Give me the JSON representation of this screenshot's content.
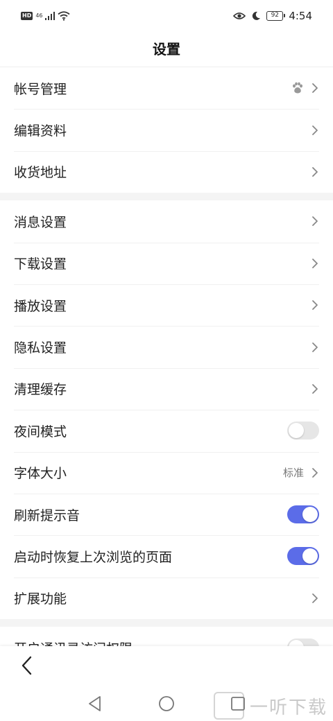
{
  "status_bar": {
    "hd": "HD",
    "network": "46",
    "battery": "92",
    "time": "4:54"
  },
  "header": {
    "title": "设置"
  },
  "sections": [
    [
      {
        "label": "帐号管理",
        "right": "chevron",
        "icon": "paw-icon"
      },
      {
        "label": "编辑资料",
        "right": "chevron"
      },
      {
        "label": "收货地址",
        "right": "chevron"
      }
    ],
    [
      {
        "label": "消息设置",
        "right": "chevron"
      },
      {
        "label": "下载设置",
        "right": "chevron"
      },
      {
        "label": "播放设置",
        "right": "chevron"
      },
      {
        "label": "隐私设置",
        "right": "chevron"
      },
      {
        "label": "清理缓存",
        "right": "chevron"
      },
      {
        "label": "夜间模式",
        "right": "toggle",
        "on": false
      },
      {
        "label": "字体大小",
        "right": "chevron",
        "value": "标准"
      },
      {
        "label": "刷新提示音",
        "right": "toggle",
        "on": true
      },
      {
        "label": "启动时恢复上次浏览的页面",
        "right": "toggle",
        "on": true
      },
      {
        "label": "扩展功能",
        "right": "chevron"
      }
    ],
    [
      {
        "label": "开启通讯录访问权限",
        "right": "toggle",
        "on": false
      }
    ]
  ],
  "watermark": {
    "text": "一听下载"
  },
  "colors": {
    "accent": "#5b6ce8",
    "toggle_off": "#e6e6e6",
    "section_gap": "#f4f4f4"
  }
}
